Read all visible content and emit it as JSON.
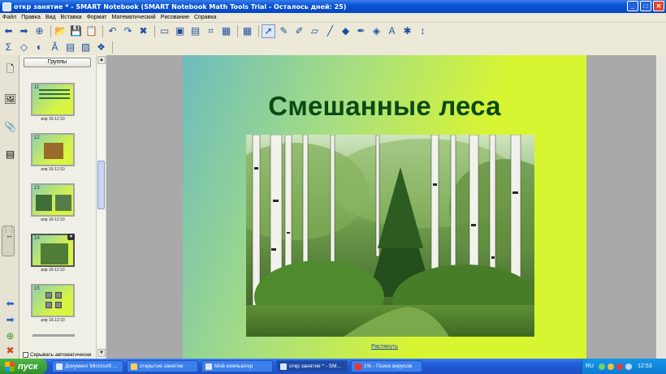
{
  "window": {
    "title": "откр занятие * - SMART Notebook (SMART Notebook Math Tools Trial - Осталось дней: 25)",
    "controls": [
      "_",
      "□",
      "✕"
    ]
  },
  "menu": [
    "Файл",
    "Правка",
    "Вид",
    "Вставка",
    "Формат",
    "Математический",
    "Рисование",
    "Справка"
  ],
  "toolbar_row1": [
    {
      "name": "back-icon",
      "glyph": "⬅"
    },
    {
      "name": "forward-icon",
      "glyph": "➡"
    },
    {
      "name": "add-page-icon",
      "glyph": "⊕"
    },
    {
      "name": "open-folder-icon",
      "glyph": "📂"
    },
    {
      "name": "save-icon",
      "glyph": "💾"
    },
    {
      "name": "paste-icon",
      "glyph": "📋"
    },
    {
      "name": "undo-icon",
      "glyph": "↶"
    },
    {
      "name": "redo-icon",
      "glyph": "↷"
    },
    {
      "name": "delete-icon",
      "glyph": "✖"
    },
    {
      "name": "screen-shade-icon",
      "glyph": "▭"
    },
    {
      "name": "full-screen-icon",
      "glyph": "▣"
    },
    {
      "name": "dual-page-icon",
      "glyph": "▤"
    },
    {
      "name": "capture-icon",
      "glyph": "⌗"
    },
    {
      "name": "document-camera-icon",
      "glyph": "▦"
    },
    {
      "name": "table-icon",
      "glyph": "▦"
    },
    {
      "name": "select-icon",
      "glyph": "➚"
    },
    {
      "name": "pen-icon",
      "glyph": "✎"
    },
    {
      "name": "creative-pen-icon",
      "glyph": "✐"
    },
    {
      "name": "eraser-icon",
      "glyph": "▱"
    },
    {
      "name": "line-icon",
      "glyph": "╱"
    },
    {
      "name": "shapes-icon",
      "glyph": "◆"
    },
    {
      "name": "magic-pen-icon",
      "glyph": "✒"
    },
    {
      "name": "fill-icon",
      "glyph": "◈"
    },
    {
      "name": "text-icon",
      "glyph": "A"
    },
    {
      "name": "properties-icon",
      "glyph": "✱"
    },
    {
      "name": "move-toolbar-icon",
      "glyph": "↕"
    }
  ],
  "toolbar_row2": [
    {
      "name": "sum-icon",
      "glyph": "Σ"
    },
    {
      "name": "shape-recognition-icon",
      "glyph": "◇"
    },
    {
      "name": "measurement-icon",
      "glyph": "◐"
    },
    {
      "name": "handwriting-icon",
      "glyph": "Â"
    },
    {
      "name": "math-text-icon",
      "glyph": "▤"
    },
    {
      "name": "graph-icon",
      "glyph": "▨"
    },
    {
      "name": "insert-object-icon",
      "glyph": "❖"
    }
  ],
  "sorter": {
    "groups_label": "Группы",
    "pages": [
      {
        "num": "11",
        "date": "апр 16-12:10"
      },
      {
        "num": "12",
        "date": "апр 16-12:10"
      },
      {
        "num": "13",
        "date": "апр 16-12:10"
      },
      {
        "num": "14",
        "date": "апр 16-12:10"
      },
      {
        "num": "15",
        "date": "апр 16-12:10"
      }
    ],
    "autohide_label": "Скрывать автоматически"
  },
  "slide": {
    "title": "Смешанные леса",
    "stretch_link": "Растянуть"
  },
  "taskbar": {
    "start_label": "пуск",
    "tasks": [
      "Документ Microsoft ...",
      "открытое занятие",
      "Мой компьютер",
      "откр занятие * - SM...",
      "1% - Поиск вирусов"
    ],
    "lang": "RU",
    "clock": "12:53"
  },
  "colors": {
    "title_green": "#0b4a14",
    "slide_lime": "#d8f532",
    "slide_teal": "#6cbcbe"
  }
}
